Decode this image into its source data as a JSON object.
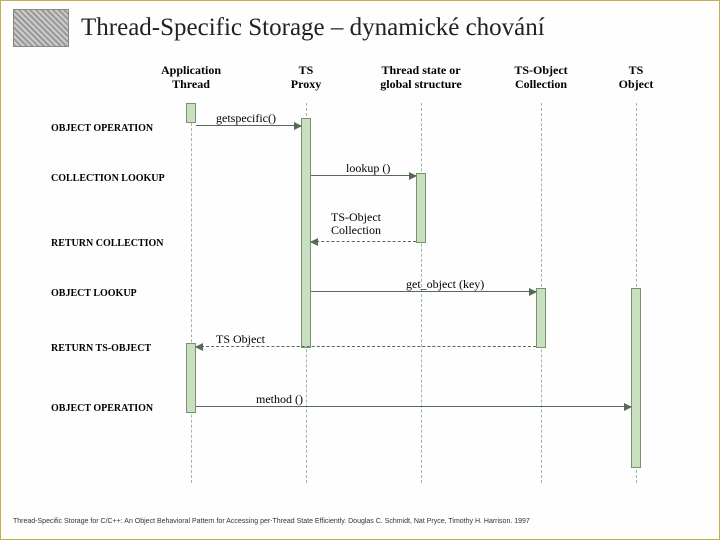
{
  "title": "Thread-Specific Storage – dynamické chování",
  "participants": {
    "p1": "Application\nThread",
    "p2": "TS\nProxy",
    "p3": "Thread state or\nglobal structure",
    "p4": "TS-Object\nCollection",
    "p5": "TS\nObject"
  },
  "events": {
    "e1": "OBJECT OPERATION",
    "e2": "COLLECTION LOOKUP",
    "e3": "RETURN COLLECTION",
    "e4": "OBJECT LOOKUP",
    "e5": "RETURN TS-OBJECT",
    "e6": "OBJECT OPERATION"
  },
  "messages": {
    "m1": "getspecific()",
    "m2": "lookup ()",
    "m3": "TS-Object\nCollection",
    "m4": "get_object (key)",
    "m5": "TS Object",
    "m6": "method ()"
  },
  "footer": "Thread-Specific Storage for C/C++: An Object Behavioral Pattern for Accessing per-Thread State Efficiently. Douglas C. Schmidt, Nat Pryce, Timothy H. Harrison. 1997",
  "chart_data": {
    "type": "sequence-diagram",
    "participants": [
      "Application Thread",
      "TS Proxy",
      "Thread state or global structure",
      "TS-Object Collection",
      "TS Object"
    ],
    "messages": [
      {
        "from": "Application Thread",
        "to": "TS Proxy",
        "label": "getspecific()",
        "kind": "call",
        "side_label": "OBJECT OPERATION"
      },
      {
        "from": "TS Proxy",
        "to": "Thread state or global structure",
        "label": "lookup ()",
        "kind": "call",
        "side_label": "COLLECTION LOOKUP"
      },
      {
        "from": "Thread state or global structure",
        "to": "TS Proxy",
        "label": "TS-Object Collection",
        "kind": "return",
        "side_label": "RETURN COLLECTION"
      },
      {
        "from": "TS Proxy",
        "to": "TS-Object Collection",
        "label": "get_object (key)",
        "kind": "call",
        "side_label": "OBJECT LOOKUP"
      },
      {
        "from": "TS-Object Collection",
        "to": "Application Thread",
        "label": "TS Object",
        "kind": "return",
        "side_label": "RETURN TS-OBJECT"
      },
      {
        "from": "Application Thread",
        "to": "TS Object",
        "label": "method ()",
        "kind": "call",
        "side_label": "OBJECT OPERATION"
      }
    ]
  }
}
